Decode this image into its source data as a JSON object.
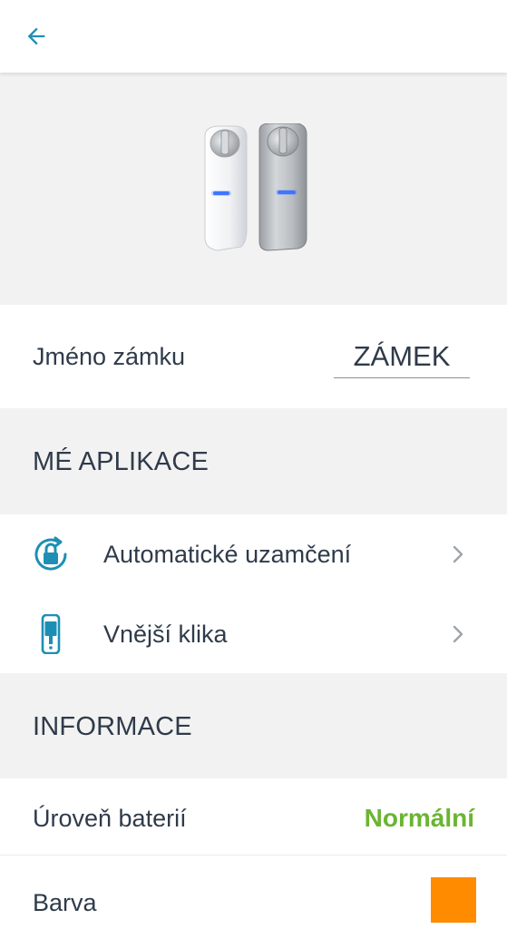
{
  "header": {
    "back_icon": "arrow-left-icon",
    "accent_color": "#1d8fb4"
  },
  "hero": {
    "image": "lock-device-product-image"
  },
  "lock_name": {
    "label": "Jméno zámku",
    "value": "ZÁMEK"
  },
  "my_apps": {
    "title": "MÉ APLIKACE",
    "items": [
      {
        "icon": "auto-lock-icon",
        "label": "Automatické uzamčení",
        "chevron": "chevron-right-icon"
      },
      {
        "icon": "outer-handle-icon",
        "label": "Vnější klika",
        "chevron": "chevron-right-icon"
      }
    ]
  },
  "info": {
    "title": "INFORMACE",
    "battery": {
      "label": "Úroveň baterií",
      "value": "Normální",
      "value_color": "#6ab531"
    },
    "color": {
      "label": "Barva",
      "swatch_color": "#ff8c00"
    }
  }
}
